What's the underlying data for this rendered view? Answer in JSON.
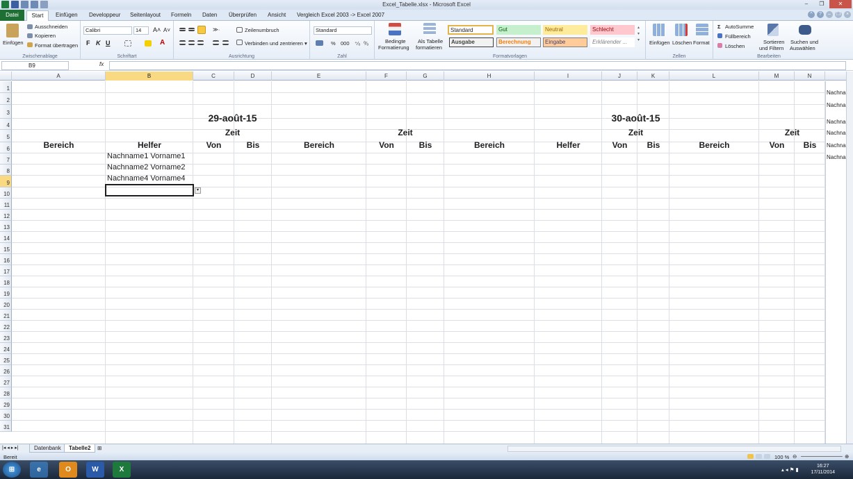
{
  "window": {
    "title": "Excel_Tabelle.xlsx - Microsoft Excel"
  },
  "tabs": [
    "Datei",
    "Start",
    "Einfügen",
    "Developpeur",
    "Seitenlayout",
    "Formeln",
    "Daten",
    "Überprüfen",
    "Ansicht",
    "Vergleich Excel 2003 -> Excel 2007"
  ],
  "ribbon": {
    "clipboard": {
      "paste": "Einfügen",
      "cut": "Ausschneiden",
      "copy": "Kopieren",
      "format_painter": "Format übertragen",
      "name": "Zwischenablage"
    },
    "font": {
      "family": "Calibri",
      "size": "14",
      "bold": "F",
      "italic": "K",
      "underline": "U",
      "name": "Schriftart"
    },
    "alignment": {
      "wrap": "Zeilenumbruch",
      "merge": "Verbinden und zentrieren",
      "name": "Ausrichtung"
    },
    "number": {
      "format": "Standard",
      "percent": "%",
      "thousands": "000",
      "name": "Zahl"
    },
    "conditional": {
      "line1": "Bedingte",
      "line2": "Formatierung"
    },
    "as_table": {
      "line1": "Als Tabelle",
      "line2": "formatieren"
    },
    "styles": {
      "standard": "Standard",
      "gut": "Gut",
      "neutral": "Neutral",
      "schlecht": "Schlecht",
      "ausgabe": "Ausgabe",
      "berechnung": "Berechnung",
      "eingabe": "Eingabe",
      "erklaerender": "Erklärender ...",
      "name": "Formatvorlagen"
    },
    "cells": {
      "insert": "Einfügen",
      "delete": "Löschen",
      "format": "Format",
      "name": "Zellen"
    },
    "editing": {
      "autosum": "AutoSumme",
      "fill": "Füllbereich",
      "clear": "Löschen",
      "sort1": "Sortieren",
      "sort2": "und Filtern",
      "find1": "Suchen und",
      "find2": "Auswählen",
      "name": "Bearbeiten"
    }
  },
  "formula_bar": {
    "name_box": "B9",
    "fx": "fx",
    "value": ""
  },
  "columns": [
    "A",
    "B",
    "C",
    "D",
    "E",
    "F",
    "G",
    "H",
    "I",
    "J",
    "K",
    "L",
    "M",
    "N"
  ],
  "rows": [
    "1",
    "2",
    "3",
    "4",
    "5",
    "6",
    "7",
    "8",
    "9",
    "10",
    "11",
    "12",
    "13",
    "14",
    "15",
    "16",
    "17",
    "18",
    "19",
    "20",
    "21",
    "22",
    "23",
    "24",
    "25",
    "26",
    "27",
    "28",
    "29",
    "30",
    "31"
  ],
  "sheet": {
    "date1": "29-août-15",
    "date2": "30-août-15",
    "zeit": "Zeit",
    "bereich": "Bereich",
    "helfer": "Helfer",
    "von": "Von",
    "bis": "Bis",
    "helpers": [
      "Nachname1 Vorname1",
      "Nachname2 Vorname2",
      "Nachname4 Vorname4"
    ],
    "right_pane": [
      "Nachna",
      "Nachna",
      "Nachna",
      "Nachna",
      "Nachna",
      "Nachna"
    ]
  },
  "sheet_tabs": [
    "Datenbank",
    "Tabelle2"
  ],
  "status": {
    "ready": "Bereit",
    "zoom": "100 %"
  },
  "taskbar": {
    "time": "16:27",
    "date": "17/11/2014"
  }
}
